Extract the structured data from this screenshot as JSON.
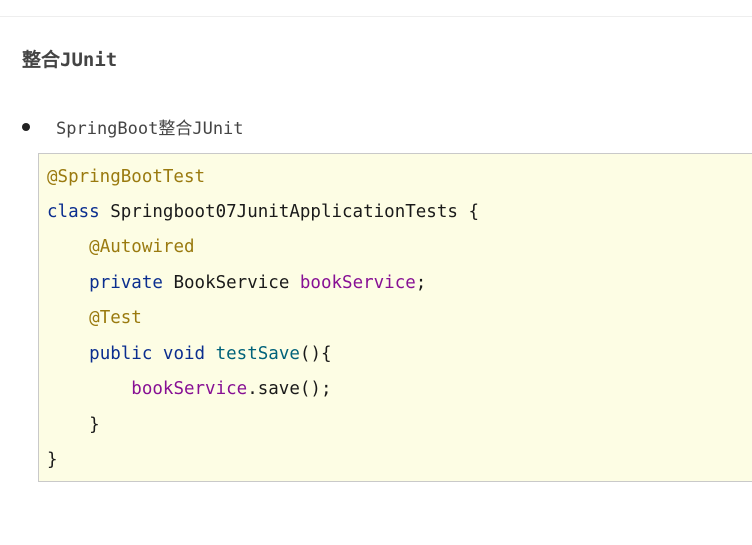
{
  "section": {
    "title": "整合JUnit"
  },
  "bullet": {
    "text": "SpringBoot整合JUnit"
  },
  "code": {
    "line1": {
      "annotation": "@SpringBootTest"
    },
    "line2": {
      "keyword": "class",
      "class_name": " Springboot07JunitApplicationTests {"
    },
    "line3": {
      "indent": "    ",
      "annotation": "@Autowired"
    },
    "line4": {
      "indent": "    ",
      "keyword": "private",
      "type": " BookService ",
      "field": "bookService",
      "end": ";"
    },
    "line5": {
      "indent": "    ",
      "annotation": "@Test"
    },
    "line6": {
      "indent": "    ",
      "keyword": "public void",
      "space": " ",
      "method": "testSave",
      "end": "(){"
    },
    "line7": {
      "indent": "        ",
      "field": "bookService",
      "call": ".save();"
    },
    "line8": {
      "text": "    }"
    },
    "line9": {
      "text": "}"
    }
  }
}
